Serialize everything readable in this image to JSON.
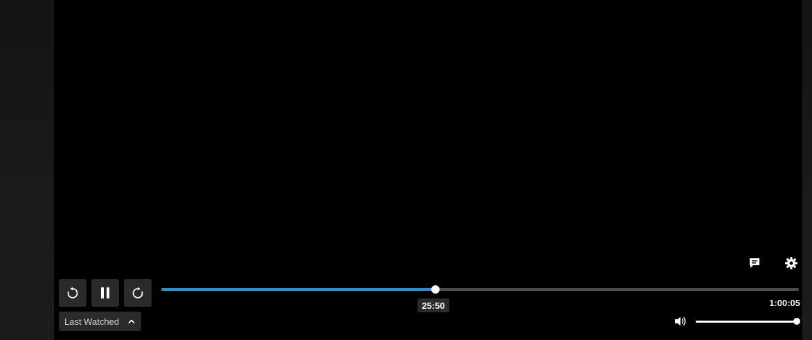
{
  "player": {
    "current_time": "25:50",
    "duration": "1:00:05",
    "progress_fraction": 0.43,
    "volume_fraction": 1.0,
    "last_watched_label": "Last Watched",
    "accent_color": "#2a8fd0"
  },
  "icons": {
    "subtitles": "subtitles-icon",
    "settings": "gear-icon",
    "rewind": "rewind-icon",
    "pause": "pause-icon",
    "forward": "forward-icon",
    "chevron": "chevron-up-icon",
    "volume": "volume-icon"
  }
}
